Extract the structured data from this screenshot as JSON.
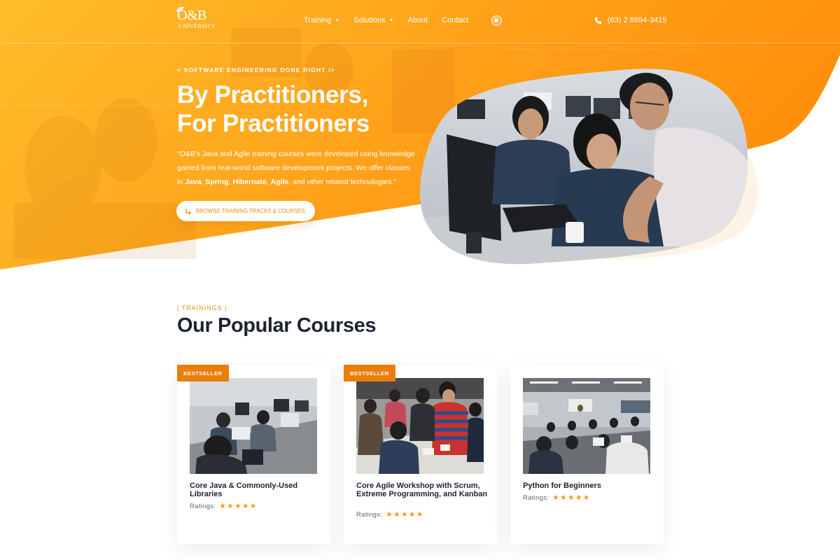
{
  "nav": {
    "logo_text": "O&B",
    "logo_sub": "UNIVERSITY",
    "items": [
      {
        "label": "Training",
        "has_dropdown": true
      },
      {
        "label": "Solutions",
        "has_dropdown": true
      },
      {
        "label": "About",
        "has_dropdown": false
      },
      {
        "label": "Contact",
        "has_dropdown": false
      }
    ],
    "badge_icon": "seal-icon",
    "phone_icon": "phone-icon",
    "phone": "(63) 2 8894-3415"
  },
  "hero": {
    "eyebrow": "< SOFTWARE ENGINEERING DONE RIGHT />",
    "title_line1": "By Practitioners,",
    "title_line2": "For Practitioners",
    "desc_part1": "\"O&B's Java and Agile training courses were developed using knowledge gained from real-world software development projects. We offer classes in ",
    "tech1": "Java",
    "sep1": ", ",
    "tech2": "Spring",
    "sep2": ", ",
    "tech3": "Hibernate",
    "sep3": ", ",
    "tech4": "Agile",
    "desc_part2": ", and other related technologies.\"",
    "button_label": "BROWSE TRAINING TRACKS & COURSES",
    "button_icon": "arrow-return-icon"
  },
  "courses": {
    "eyebrow": "| TRAININGS |",
    "title": "Our Popular Courses",
    "items": [
      {
        "badge": "BESTSELLER",
        "title": "Core Java & Commonly-Used Libraries",
        "ratings_label": "Ratings:",
        "stars": 5,
        "stars_text": "★★★★★"
      },
      {
        "badge": "BESTSELLER",
        "title": "Core Agile Workshop with Scrum, Extreme Programming, and Kanban",
        "ratings_label": "Ratings:",
        "stars": 5,
        "stars_text": "★★★★★"
      },
      {
        "badge": "",
        "title": "Python for Beginners",
        "ratings_label": "Ratings:",
        "stars": 5,
        "stars_text": "★★★★★"
      }
    ]
  },
  "colors": {
    "accent": "#f08c0f",
    "orange_light": "#ffb41e",
    "badge": "#e97e0b",
    "dark_text": "#1d2330"
  }
}
